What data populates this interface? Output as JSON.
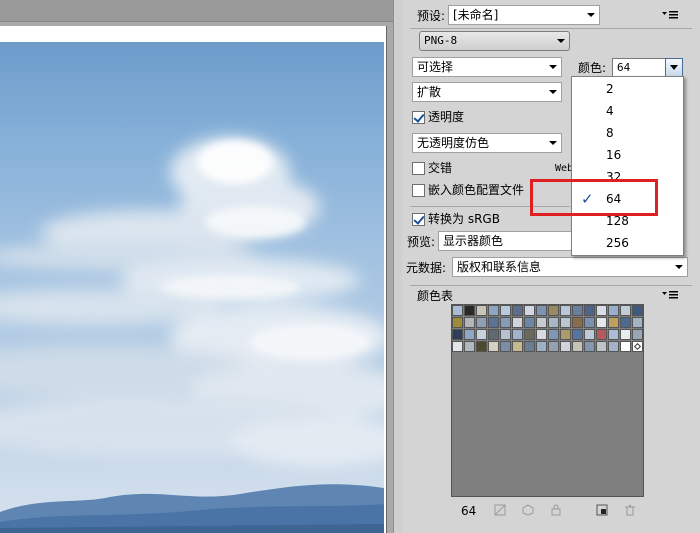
{
  "preset": {
    "label": "预设:",
    "value": "[未命名]"
  },
  "format": {
    "value": "PNG-8"
  },
  "reduction": {
    "value": "可选择"
  },
  "colors": {
    "label": "颜色:",
    "value": "64"
  },
  "dither": {
    "value": "扩散"
  },
  "transparency": {
    "label": "透明度",
    "checked": true
  },
  "transparency_dither": {
    "value": "无透明度仿色"
  },
  "interlaced": {
    "label": "交错",
    "checked": false
  },
  "web_snap": {
    "label": "Web"
  },
  "embed_profile": {
    "label": "嵌入颜色配置文件",
    "checked": false
  },
  "convert_srgb": {
    "label": "转换为 sRGB",
    "checked": true
  },
  "preview": {
    "label": "预览:",
    "value": "显示器颜色"
  },
  "metadata": {
    "label": "元数据:",
    "value": "版权和联系信息"
  },
  "color_table": {
    "title": "颜色表",
    "count": "64",
    "swatches": [
      "#a8bcd4",
      "#2a2a24",
      "#c9c4b5",
      "#8ea6c2",
      "#b7c9dc",
      "#5b6e8a",
      "#cfd8e2",
      "#7d93b0",
      "#9a8a62",
      "#b9c8d8",
      "#68809e",
      "#4c6489",
      "#d8dde6",
      "#98aecb",
      "#c2ccd6",
      "#3d5a80",
      "#a08a3a",
      "#b2b6b8",
      "#90a0b4",
      "#5a7296",
      "#879bb8",
      "#d0d5dc",
      "#6e86a6",
      "#c6cbd2",
      "#a9b6c6",
      "#bcc6d0",
      "#8b6b4a",
      "#7b90ae",
      "#e4e8ec",
      "#bd9f5e",
      "#4d6b92",
      "#a3b2c4",
      "#2e3e58",
      "#8fa7c4",
      "#c9d2dc",
      "#5e6a72",
      "#b6c2d0",
      "#9fb4cc",
      "#6a6a5c",
      "#d6dce2",
      "#7f96b4",
      "#ab9c6c",
      "#5574a0",
      "#c0cad6",
      "#b45a5a",
      "#a9bed6",
      "#e8ecf0",
      "#98a6b6",
      "#e2e6ea",
      "#b0b8c0",
      "#4a4a2c",
      "#d4d0c4",
      "#7b8ea8",
      "#c8b890",
      "#6c7e94",
      "#9cb0c8",
      "#94a2b0",
      "#ced4da",
      "#c4c4b4",
      "#8497ae",
      "#bcc4c8",
      "#a4b4c6",
      "#ffffff",
      "#ffffff"
    ]
  },
  "color_options": [
    "2",
    "4",
    "8",
    "16",
    "32",
    "64",
    "128",
    "256"
  ],
  "selected_color_option": "64",
  "icons": {
    "panel_menu": "panel-menu-icon",
    "map_to_transparent": "map-transparent-icon",
    "web_shift": "web-shift-icon",
    "lock": "lock-icon",
    "new_color": "new-color-icon",
    "delete": "trash-icon"
  },
  "accent": {
    "highlight": "#e02020",
    "check": "#1a4fa0"
  }
}
